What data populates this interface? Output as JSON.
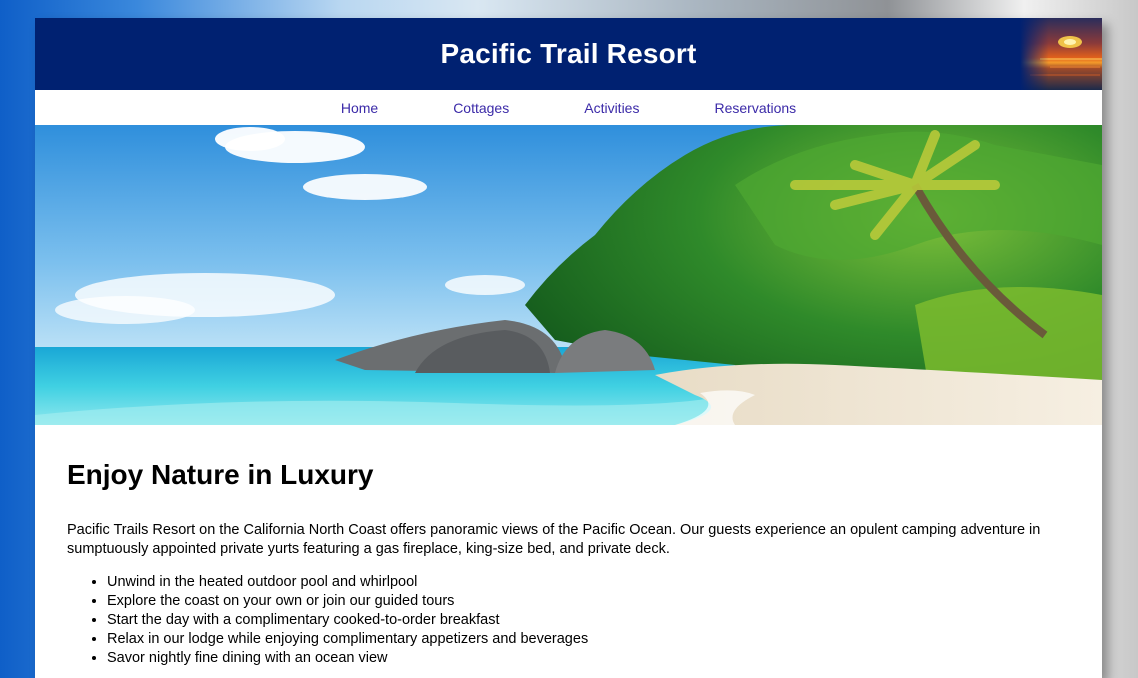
{
  "site": {
    "title": "Pacific Trail Resort"
  },
  "nav": {
    "items": [
      {
        "label": "Home"
      },
      {
        "label": "Cottages"
      },
      {
        "label": "Activities"
      },
      {
        "label": "Reservations"
      }
    ]
  },
  "main": {
    "heading": "Enjoy Nature in Luxury",
    "intro": "Pacific Trails Resort on the California North Coast offers panoramic views of the Pacific Ocean. Our guests experience an opulent camping adventure in sumptuously appointed private yurts featuring a gas fireplace, king-size bed, and private deck.",
    "features": [
      "Unwind in the heated outdoor pool and whirlpool",
      "Explore the coast on your own or join our guided tours",
      "Start the day with a complimentary cooked-to-order breakfast",
      "Relax in our lodge while enjoying complimentary appetizers and beverages",
      "Savor nightly fine dining with an ocean view"
    ]
  },
  "colors": {
    "header_bg": "#002171",
    "nav_link": "#3b2aa8"
  }
}
